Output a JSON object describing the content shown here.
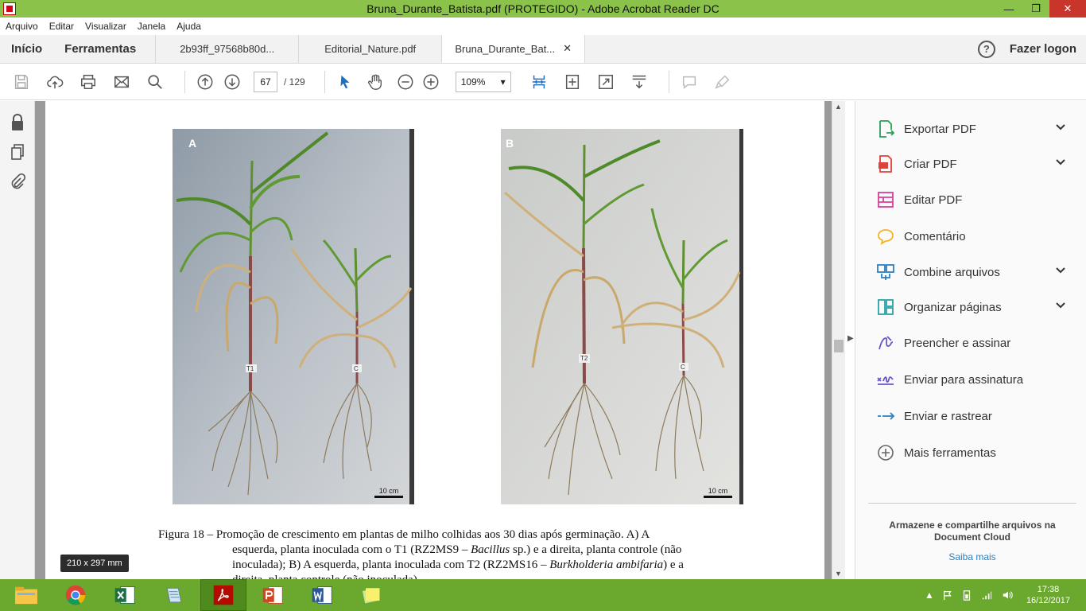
{
  "window": {
    "title": "Bruna_Durante_Batista.pdf (PROTEGIDO) - Adobe Acrobat Reader DC",
    "minimize": "—",
    "restore": "❐",
    "close": "✕"
  },
  "menu": [
    "Arquivo",
    "Editar",
    "Visualizar",
    "Janela",
    "Ajuda"
  ],
  "tabs": {
    "home": "Início",
    "tools": "Ferramentas",
    "docs": [
      {
        "label": "2b93ff_97568b80d..."
      },
      {
        "label": "Editorial_Nature.pdf"
      },
      {
        "label": "Bruna_Durante_Bat...",
        "close": "✕"
      }
    ],
    "help": "?",
    "login": "Fazer logon"
  },
  "toolbar": {
    "page_current": "67",
    "page_total": "/  129",
    "zoom": "109%",
    "zoom_arrow": "▾"
  },
  "document": {
    "photo_a_label": "A",
    "photo_b_label": "B",
    "scale_label": "10 cm",
    "tag_a1": "T1",
    "tag_a2": "C",
    "tag_b1": "T2",
    "tag_b2": "C",
    "caption_line1": "Figura  18  –  Promoção  de  crescimento  em  plantas  de  milho  colhidas  aos  30  dias  após  germinação.  A)  A",
    "caption_line2a": "esquerda,  planta  inoculada  com  o  T1  (RZ2MS9  –  ",
    "caption_line2b": "Bacillus",
    "caption_line2c": " sp.)  e  a  direita,  planta  controle  (não",
    "caption_line3a": "inoculada);  B)  A  esquerda,  planta  inoculada  com  T2  (RZ2MS16  –  ",
    "caption_line3b": "Burkholderia ambifaria",
    "caption_line3c": ")   e  a",
    "caption_line4": "direita, planta controle (não inoculada).",
    "size_tooltip": "210 x 297 mm"
  },
  "right_panel": {
    "tools": [
      {
        "label": "Exportar PDF",
        "color": "#2e9c5a"
      },
      {
        "label": "Criar PDF",
        "color": "#e0413a"
      },
      {
        "label": "Editar PDF",
        "color": "#d8409a"
      },
      {
        "label": "Comentário",
        "color": "#f2b521"
      },
      {
        "label": "Combine arquivos",
        "color": "#2d7fc2"
      },
      {
        "label": "Organizar páginas",
        "color": "#27a3a8"
      },
      {
        "label": "Preencher e assinar",
        "color": "#6b55c9"
      },
      {
        "label": "Enviar para assinatura",
        "color": "#6b55c9"
      },
      {
        "label": "Enviar e rastrear",
        "color": "#2d7fc2"
      },
      {
        "label": "Mais ferramentas",
        "color": "#666666"
      }
    ],
    "cloud_text": "Armazene e compartilhe arquivos na Document Cloud",
    "cloud_link": "Saiba mais"
  },
  "taskbar": {
    "time": "17:38",
    "date": "16/12/2017"
  }
}
